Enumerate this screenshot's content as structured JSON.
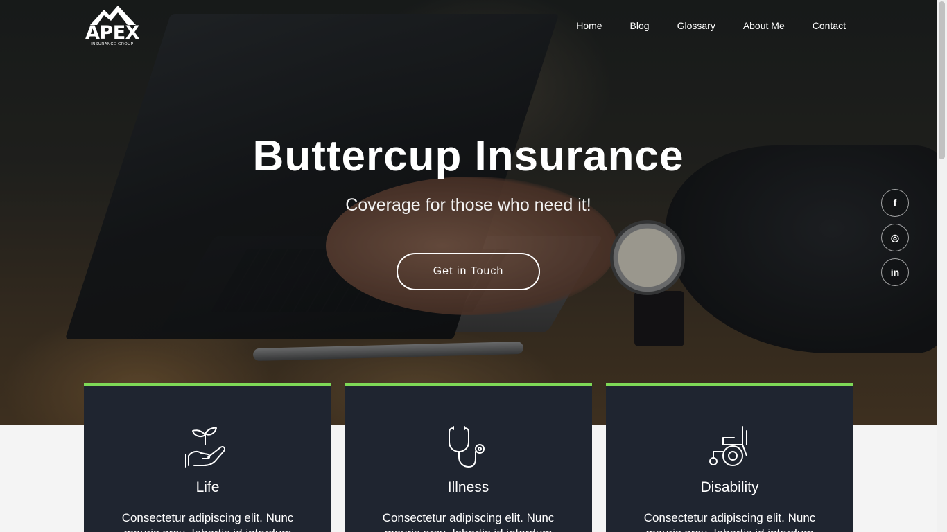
{
  "brand": {
    "name": "APEX",
    "tagline": "INSURANCE GROUP",
    "logo_icon": "mountain-icon"
  },
  "nav": {
    "items": [
      {
        "label": "Home"
      },
      {
        "label": "Blog"
      },
      {
        "label": "Glossary"
      },
      {
        "label": "About Me"
      },
      {
        "label": "Contact"
      }
    ]
  },
  "hero": {
    "title": "Buttercup Insurance",
    "subtitle": "Coverage for those who need it!",
    "cta_label": "Get in Touch"
  },
  "socials": [
    {
      "label": "f",
      "icon": "facebook-icon"
    },
    {
      "label": "◎",
      "icon": "instagram-icon"
    },
    {
      "label": "in",
      "icon": "linkedin-icon"
    }
  ],
  "cards": [
    {
      "title": "Life",
      "icon": "plant-in-hand-icon",
      "desc": "Consectetur adipiscing elit. Nunc mauris arcu, lobortis id interdum"
    },
    {
      "title": "Illness",
      "icon": "stethoscope-icon",
      "desc": "Consectetur adipiscing elit. Nunc mauris arcu, lobortis id interdum"
    },
    {
      "title": "Disability",
      "icon": "wheelchair-icon",
      "desc": "Consectetur adipiscing elit. Nunc mauris arcu, lobortis id interdum"
    }
  ],
  "colors": {
    "accent": "#7ed957",
    "card_bg": "#1f2530",
    "page_bg": "#f4f4f4"
  }
}
